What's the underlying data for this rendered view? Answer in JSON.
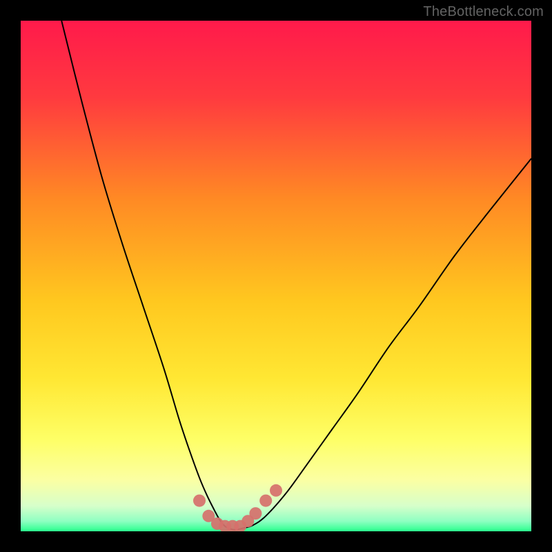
{
  "watermark": {
    "text": "TheBottleneck.com"
  },
  "chart_data": {
    "type": "line",
    "title": "",
    "xlabel": "",
    "ylabel": "",
    "xlim": [
      0,
      100
    ],
    "ylim": [
      0,
      100
    ],
    "grid": false,
    "legend": false,
    "background_gradient": {
      "top_color": "#ff1a4b",
      "mid_color_1": "#ff8a24",
      "mid_color_2": "#ffe733",
      "near_bottom_color": "#fbffa3",
      "bottom_color": "#29ff8d",
      "direction": "vertical"
    },
    "series": [
      {
        "name": "curve",
        "stroke": "#000000",
        "stroke_width": 2,
        "x": [
          8,
          12,
          16,
          20,
          24,
          28,
          31,
          33,
          35,
          36.5,
          38,
          39,
          40,
          41,
          42,
          43.5,
          45.5,
          48,
          52,
          56,
          61,
          66,
          72,
          78,
          85,
          92,
          100
        ],
        "y": [
          100,
          84,
          69,
          56,
          44,
          32,
          22,
          16,
          10.5,
          7,
          4,
          2.2,
          1,
          0.5,
          0.3,
          0.6,
          1.2,
          3,
          7.5,
          13,
          20,
          27,
          36,
          44,
          54,
          63,
          73
        ]
      },
      {
        "name": "bottom-dots",
        "type": "scatter",
        "marker_color": "#d6706b",
        "marker_radius": 9,
        "x": [
          35.0,
          36.8,
          38.5,
          40.0,
          41.5,
          43.0,
          44.5,
          46.0,
          48.0,
          50.0
        ],
        "y": [
          6.0,
          3.0,
          1.5,
          1.0,
          1.0,
          1.0,
          2.0,
          3.5,
          6.0,
          8.0
        ]
      }
    ],
    "notes": "V-shaped bottleneck curve over vertical rainbow gradient; minimum near x≈41; left branch steeper than right. Y-axis is 0–100 (percent-like), x-axis 0–100 (normalized). Axis ticks/labels not shown in image."
  }
}
